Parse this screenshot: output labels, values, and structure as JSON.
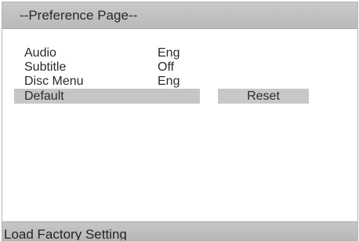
{
  "header": {
    "title": "--Preference Page--"
  },
  "menu": {
    "items": [
      {
        "label": "Audio",
        "value": "Eng"
      },
      {
        "label": "Subtitle",
        "value": "Off"
      },
      {
        "label": "Disc Menu",
        "value": "Eng"
      },
      {
        "label": "Default",
        "value": ""
      }
    ],
    "selected_index": 3,
    "submenu_option": "Reset"
  },
  "footer": {
    "status_text": "Load Factory Setting"
  },
  "colors": {
    "header_background": "#c1c1c1",
    "selected_background": "#c6c6c6",
    "text": "#2b2b2b"
  }
}
